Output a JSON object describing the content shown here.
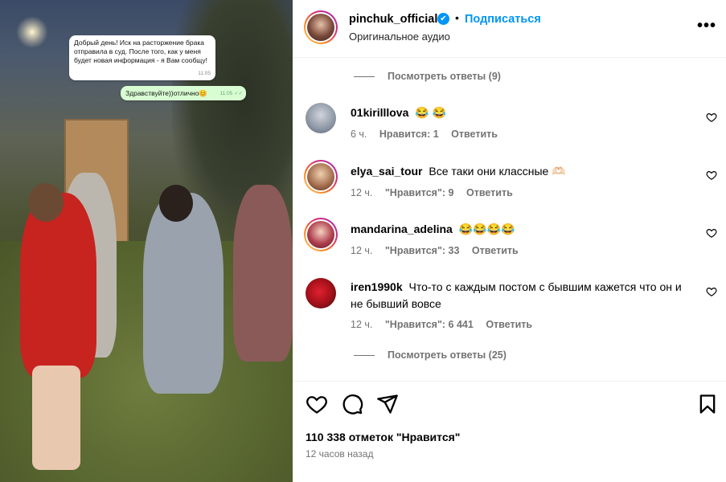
{
  "media": {
    "message_in": "Добрый день! Иск на расторжение брака отправила в суд. После того, как у меня будет новая информация - я Вам сообщу!",
    "message_in_time": "11:05",
    "message_out": "Здравствуйте))отлично😊",
    "message_out_time": "11:05 ✓✓"
  },
  "header": {
    "username": "pinchuk_official",
    "verified_icon": "✔",
    "separator": "•",
    "follow_label": "Подписаться",
    "audio_label": "Оригинальное аудио",
    "more_label": "•••"
  },
  "replies_top": {
    "label": "Посмотреть ответы (9)"
  },
  "comments": [
    {
      "username": "01kirilllova",
      "text": "😂 😂",
      "time": "6 ч.",
      "likes": "Нравится: 1",
      "reply": "Ответить"
    },
    {
      "username": "elya_sai_tour",
      "text": "Все таки они классные 🫶🏻",
      "time": "12 ч.",
      "likes": "\"Нравится\": 9",
      "reply": "Ответить"
    },
    {
      "username": "mandarina_adelina",
      "text": "😂😂😂😂",
      "time": "12 ч.",
      "likes": "\"Нравится\": 33",
      "reply": "Ответить"
    },
    {
      "username": "iren1990k",
      "text": "Что-то с каждым постом с бывшим кажется что он и не бывший вовсе",
      "time": "12 ч.",
      "likes": "\"Нравится\": 6 441",
      "reply": "Ответить"
    }
  ],
  "replies_bottom": {
    "label": "Посмотреть ответы (25)"
  },
  "footer": {
    "likes": "110 338 отметок \"Нравится\"",
    "time_ago": "12 часов назад"
  },
  "colors": {
    "accent": "#0095f6",
    "muted": "#737373"
  }
}
